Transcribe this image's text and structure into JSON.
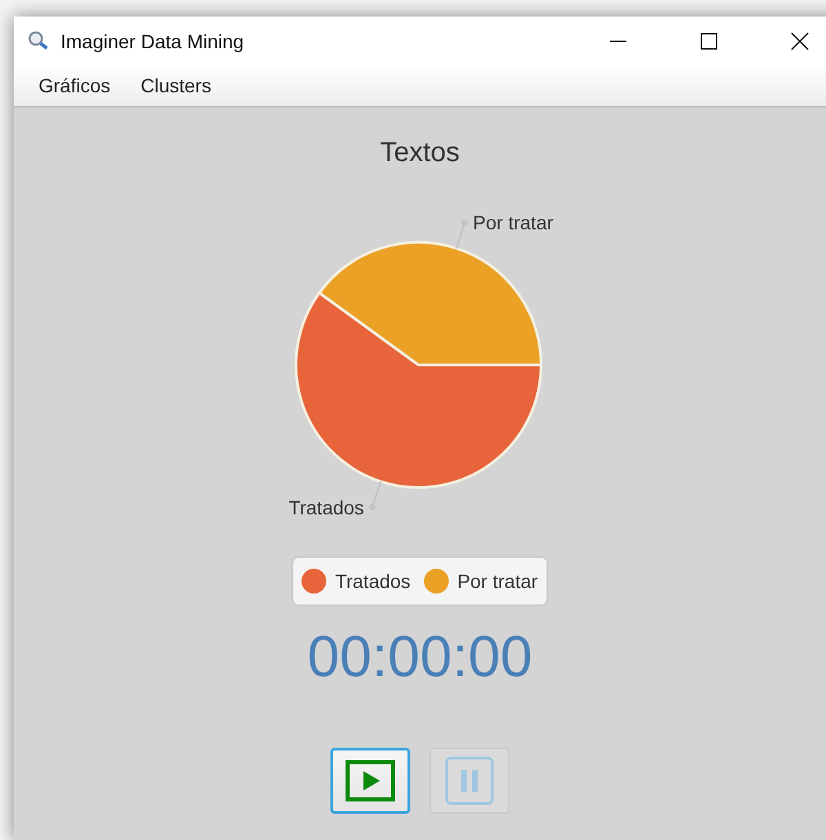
{
  "window": {
    "title": "Imaginer Data Mining"
  },
  "menu": [
    "Gráficos",
    "Clusters"
  ],
  "chart": {
    "chart_data": {
      "type": "pie",
      "title": "Textos",
      "categories": [
        "Tratados",
        "Por tratar"
      ],
      "values": [
        60,
        40
      ]
    },
    "slices": [
      {
        "color": "#e8643a"
      },
      {
        "color": "#eaa126"
      }
    ]
  },
  "timer": "00:00:00",
  "buttons": [
    {
      "kind": "play",
      "focused": true,
      "disabled": false
    },
    {
      "kind": "pause",
      "focused": false,
      "disabled": true
    }
  ]
}
